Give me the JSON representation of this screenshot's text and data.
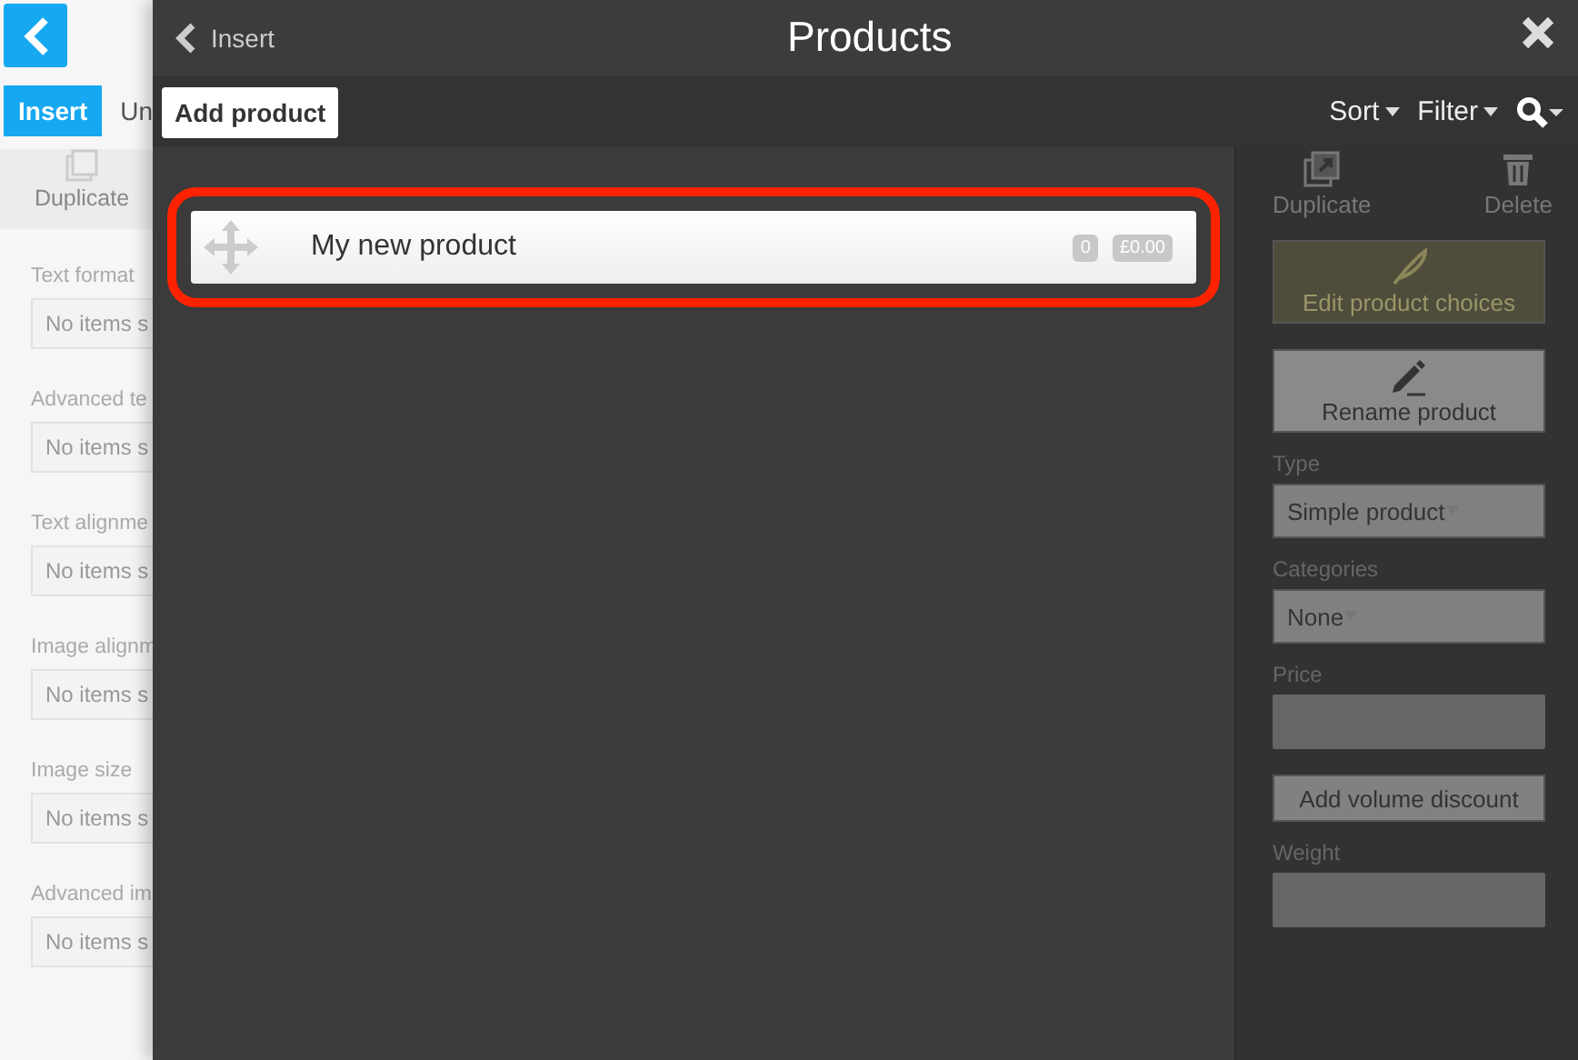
{
  "background_page": {
    "tabs": [
      {
        "label": "Insert",
        "selected": true
      },
      {
        "label": "Un",
        "selected": false
      }
    ],
    "duplicate_label": "Duplicate",
    "fields": [
      {
        "label": "Text format",
        "value": "No items s"
      },
      {
        "label": "Advanced te",
        "value": "No items s"
      },
      {
        "label": "Text alignme",
        "value": "No items s"
      },
      {
        "label": "Image alignm",
        "value": "No items s"
      },
      {
        "label": "Image size",
        "value": "No items s"
      },
      {
        "label": "Advanced im",
        "value": "No items s"
      }
    ]
  },
  "dialog": {
    "back_label": "Insert",
    "title": "Products",
    "toolbar": {
      "add_button": "Add product",
      "sort": "Sort",
      "filter": "Filter"
    },
    "products": [
      {
        "name": "My new product",
        "count": "0",
        "price": "£0.00",
        "highlighted": true
      }
    ],
    "side_panel": {
      "duplicate": "Duplicate",
      "delete": "Delete",
      "actions": [
        {
          "label": "Edit product choices",
          "disabled": true
        },
        {
          "label": "Rename product",
          "disabled": false
        }
      ],
      "fields": [
        {
          "kind": "select",
          "label": "Type",
          "value": "Simple product"
        },
        {
          "kind": "select",
          "label": "Categories",
          "value": "None"
        },
        {
          "kind": "input",
          "label": "Price"
        },
        {
          "kind": "button",
          "label": "Add volume discount"
        },
        {
          "kind": "input",
          "label": "Weight"
        }
      ]
    }
  }
}
